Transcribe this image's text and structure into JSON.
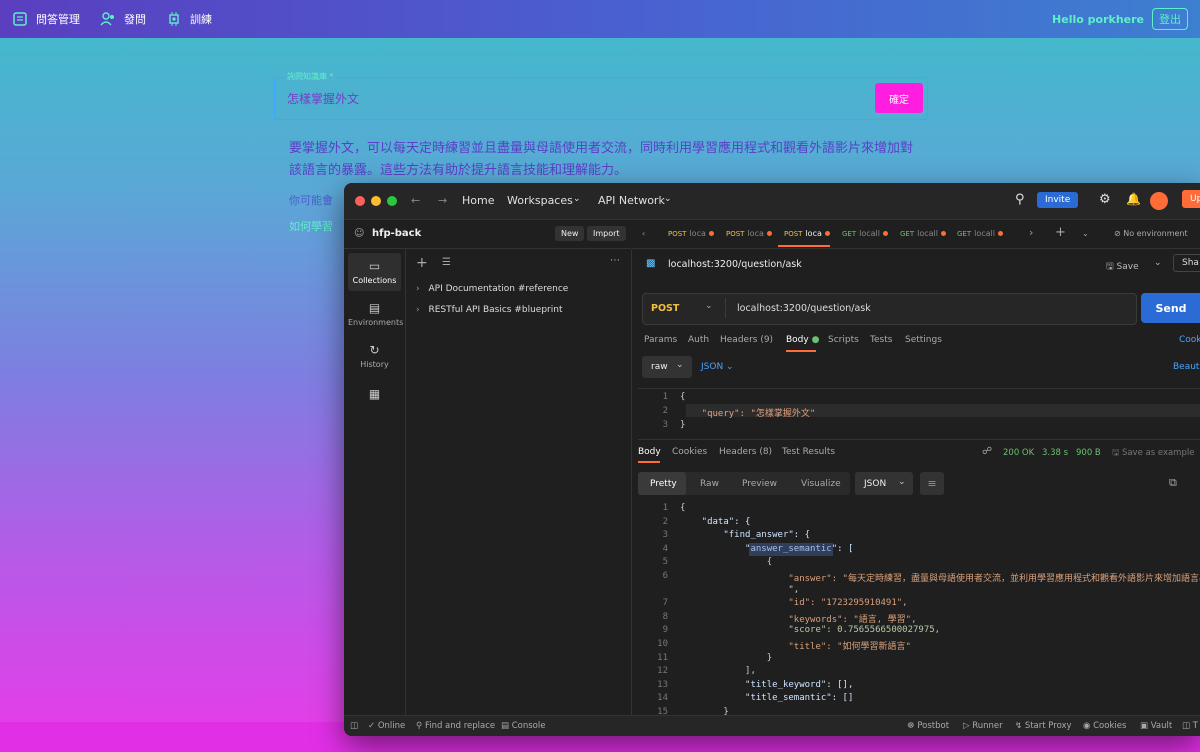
{
  "nav": {
    "items": [
      {
        "label": "問答管理",
        "icon": "list-icon"
      },
      {
        "label": "發問",
        "icon": "users-icon"
      },
      {
        "label": "訓練",
        "icon": "chip-icon"
      }
    ],
    "greeting": "Hello porkhere",
    "logout": "登出"
  },
  "query": {
    "label": "詢問知識庫 *",
    "value": "怎樣掌握外文",
    "confirm": "確定"
  },
  "answer": "要掌握外文，可以每天定時練習並且盡量與母語使用者交流，同時利用學習應用程式和觀看外語影片來增加對該語言的暴露。這些方法有助於提升語言技能和理解能力。",
  "maybe_prefix": "你可能會",
  "suggestion_prefix": "如何學習",
  "postman": {
    "nav": {
      "home": "Home",
      "workspaces": "Workspaces",
      "api_network": "API Network",
      "invite": "Invite",
      "upgrade": "Up"
    },
    "workspace": {
      "name": "hfp-back",
      "new": "New",
      "import": "Import"
    },
    "sidebar": [
      {
        "label": "Collections",
        "icon": "collections-icon"
      },
      {
        "label": "Environments",
        "icon": "environments-icon"
      },
      {
        "label": "History",
        "icon": "history-icon"
      }
    ],
    "collections": [
      "API Documentation #reference",
      "RESTful API Basics #blueprint"
    ],
    "tabs": [
      {
        "method": "POST",
        "name": "loca",
        "active": false
      },
      {
        "method": "POST",
        "name": "loca",
        "active": false
      },
      {
        "method": "POST",
        "name": "loca",
        "active": true
      },
      {
        "method": "GET",
        "name": "locall",
        "active": false
      },
      {
        "method": "GET",
        "name": "locall",
        "active": false
      },
      {
        "method": "GET",
        "name": "locall",
        "active": false
      }
    ],
    "environment": "No environment",
    "share": "Sha",
    "request_title": "localhost:3200/question/ask",
    "save": "Save",
    "method": "POST",
    "url": "localhost:3200/question/ask",
    "send": "Send",
    "req_tabs": [
      "Params",
      "Auth",
      "Headers (9)",
      "Body",
      "Scripts",
      "Tests",
      "Settings"
    ],
    "cookies": "Cook",
    "body_mode": "raw",
    "body_format": "JSON",
    "beautify": "Beauti",
    "request_body": [
      "{",
      "    \"query\": \"怎樣掌握外文\"",
      "}"
    ],
    "resp_tabs": [
      "Body",
      "Cookies",
      "Headers (8)",
      "Test Results"
    ],
    "status": "200 OK",
    "time": "3.38 s",
    "size": "900 B",
    "save_example": "Save as example",
    "view_modes": [
      "Pretty",
      "Raw",
      "Preview",
      "Visualize"
    ],
    "resp_format": "JSON",
    "response_lines": [
      "{",
      "    \"data\": {",
      "        \"find_answer\": {",
      "            \"answer_semantic\": [",
      "                {",
      "                    \"answer\": \"每天定時練習，盡量與母語使用者交流，並利用學習應用程式和觀看外語影片來增加語言暴露",
      "                    \",",
      "                    \"id\": \"1723295910491\",",
      "                    \"keywords\": \"語言, 學習\",",
      "                    \"score\": 0.7565566500027975,",
      "                    \"title\": \"如何學習新語言\"",
      "                }",
      "            ],",
      "            \"title_keyword\": [],",
      "            \"title_semantic\": []",
      "        }"
    ],
    "response_line_numbers": [
      "1",
      "2",
      "3",
      "4",
      "5",
      "6",
      "",
      "7",
      "8",
      "9",
      "10",
      "11",
      "12",
      "13",
      "14",
      "15"
    ],
    "statusbar": {
      "online": "Online",
      "find": "Find and replace",
      "console": "Console",
      "postbot": "Postbot",
      "runner": "Runner",
      "proxy": "Start Proxy",
      "cookies": "Cookies",
      "vault": "Vault",
      "trash": "T"
    }
  }
}
